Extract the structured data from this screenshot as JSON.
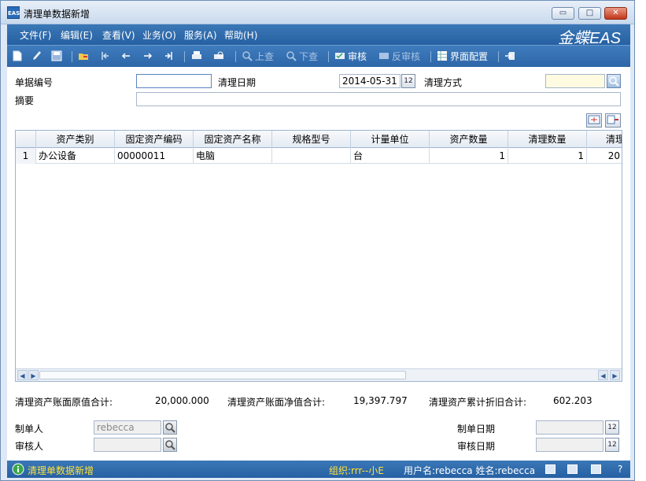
{
  "window": {
    "icon_text": "EAS",
    "title": "清理单数据新增",
    "min_glyph": "▭",
    "max_glyph": "□",
    "close_glyph": "✕"
  },
  "menu": {
    "items": [
      "文件(F)",
      "编辑(E)",
      "查看(V)",
      "业务(O)",
      "服务(A)",
      "帮助(H)"
    ],
    "brand": "金蝶EAS"
  },
  "toolbar": {
    "prev_label": "上查",
    "next_label": "下查",
    "audit_label": "审核",
    "unaudit_label": "反审核",
    "config_label": "界面配置"
  },
  "form": {
    "bill_no_label": "单据编号",
    "bill_no_value": "",
    "date_label": "清理日期",
    "date_value": "2014-05-31",
    "date_btn": "12",
    "method_label": "清理方式",
    "method_value": "",
    "summary_label": "摘要",
    "summary_value": ""
  },
  "table": {
    "columns": [
      "资产类别",
      "固定资产编码",
      "固定资产名称",
      "规格型号",
      "计量单位",
      "资产数量",
      "清理数量",
      "清理"
    ],
    "rows": [
      {
        "index": "1",
        "cells": [
          "办公设备",
          "00000011",
          "电脑",
          "",
          "台",
          "1",
          "1",
          "20"
        ]
      }
    ]
  },
  "totals": {
    "orig_label": "清理资产账面原值合计:",
    "orig_value": "20,000.000",
    "net_label": "清理资产账面净值合计:",
    "net_value": "19,397.797",
    "dep_label": "清理资产累计折旧合计:",
    "dep_value": "602.203"
  },
  "footer": {
    "creator_label": "制单人",
    "creator_value": "rebecca",
    "auditor_label": "审核人",
    "auditor_value": "",
    "create_date_label": "制单日期",
    "create_date_value": "",
    "audit_date_label": "审核日期",
    "audit_date_value": "",
    "date_btn": "12"
  },
  "statusbar": {
    "title": "清理单数据新增",
    "org": "组织:rrr--小E",
    "user": "用户名:rebecca 姓名:rebecca",
    "help": "?"
  }
}
